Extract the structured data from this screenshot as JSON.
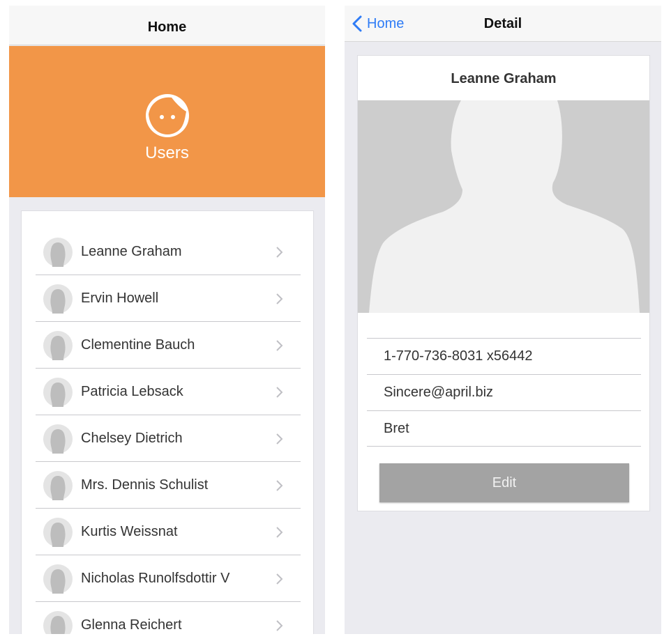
{
  "left": {
    "nav_title": "Home",
    "hero": {
      "label": "Users",
      "color": "#f29648",
      "icon": "face-icon"
    },
    "users": [
      {
        "name": "Leanne Graham"
      },
      {
        "name": "Ervin Howell"
      },
      {
        "name": "Clementine Bauch"
      },
      {
        "name": "Patricia Lebsack"
      },
      {
        "name": "Chelsey Dietrich"
      },
      {
        "name": "Mrs. Dennis Schulist"
      },
      {
        "name": "Kurtis Weissnat"
      },
      {
        "name": "Nicholas Runolfsdottir V"
      },
      {
        "name": "Glenna Reichert"
      }
    ]
  },
  "right": {
    "back_label": "Home",
    "nav_title": "Detail",
    "user_name": "Leanne Graham",
    "phone": "1-770-736-8031 x56442",
    "email": "Sincere@april.biz",
    "username": "Bret",
    "edit_label": "Edit"
  },
  "colors": {
    "accent": "#2f7cf6",
    "hero": "#f29648",
    "button": "#a3a3a3"
  }
}
